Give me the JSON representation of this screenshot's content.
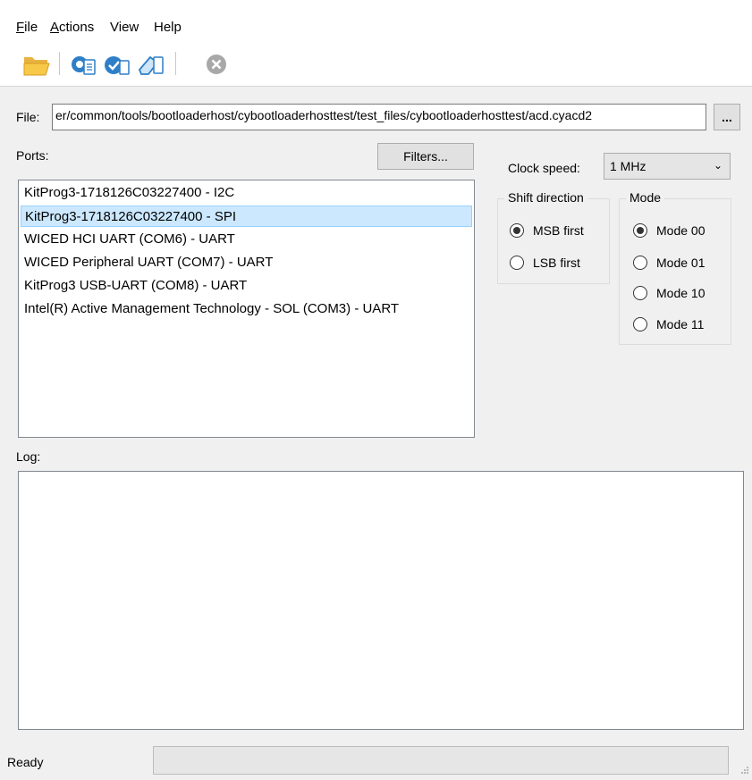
{
  "menu": {
    "file": "File",
    "actions": "Actions",
    "view": "View",
    "help": "Help"
  },
  "toolbar": {
    "icons": [
      "open-folder-icon",
      "program-icon",
      "verify-icon",
      "erase-icon",
      "abort-icon"
    ]
  },
  "file": {
    "label": "File:",
    "path": "er/common/tools/bootloaderhost/cybootloaderhosttest/test_files/cybootloaderhosttest/acd.cyacd2",
    "browse": "..."
  },
  "ports": {
    "label": "Ports:",
    "filters": "Filters...",
    "items": [
      "KitProg3-1718126C03227400 - I2C",
      "KitProg3-1718126C03227400 - SPI",
      "WICED HCI UART (COM6) - UART",
      "WICED Peripheral UART (COM7) - UART",
      "KitProg3 USB-UART (COM8) - UART",
      "Intel(R) Active Management Technology - SOL (COM3) - UART"
    ],
    "selected_index": 1
  },
  "clock": {
    "label": "Clock speed:",
    "value": "1 MHz"
  },
  "shift": {
    "title": "Shift direction",
    "options": [
      "MSB first",
      "LSB first"
    ],
    "selected": "MSB first"
  },
  "mode": {
    "title": "Mode",
    "options": [
      "Mode 00",
      "Mode 01",
      "Mode 10",
      "Mode 11"
    ],
    "selected": "Mode 00"
  },
  "log": {
    "label": "Log:",
    "content": ""
  },
  "status": {
    "text": "Ready",
    "progress": 0
  }
}
